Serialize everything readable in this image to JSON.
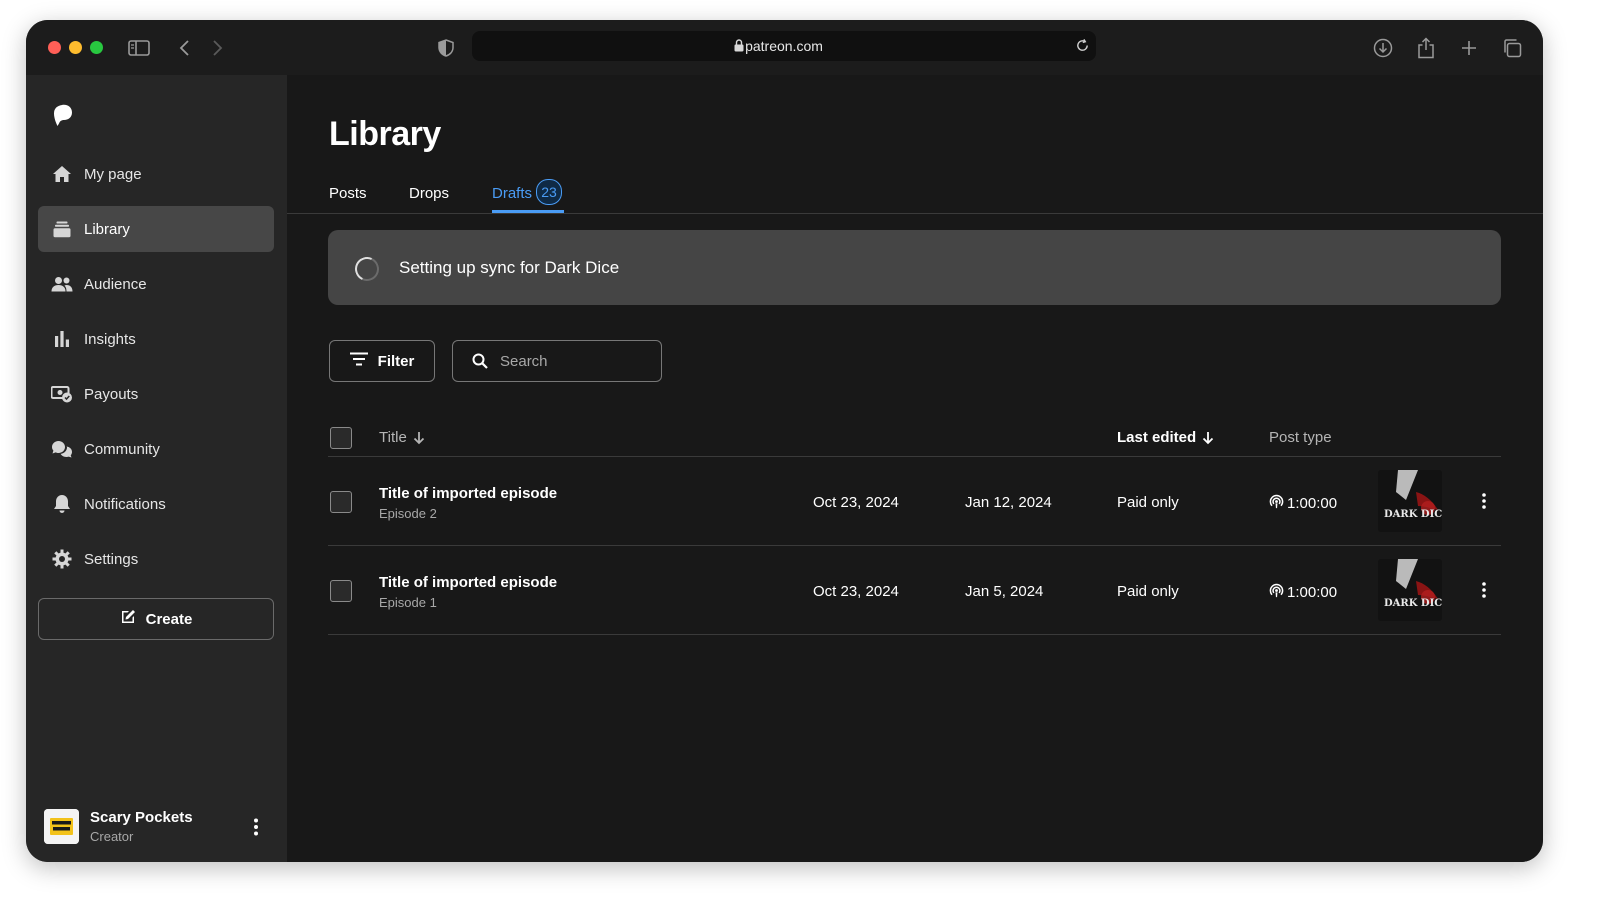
{
  "browser": {
    "url": "patreon.com"
  },
  "sidebar": {
    "items": [
      {
        "label": "My page",
        "icon": "home-icon"
      },
      {
        "label": "Library",
        "icon": "library-icon",
        "active": true
      },
      {
        "label": "Audience",
        "icon": "audience-icon"
      },
      {
        "label": "Insights",
        "icon": "insights-icon"
      },
      {
        "label": "Payouts",
        "icon": "payouts-icon"
      },
      {
        "label": "Community",
        "icon": "community-icon"
      },
      {
        "label": "Notifications",
        "icon": "bell-icon"
      },
      {
        "label": "Settings",
        "icon": "gear-icon"
      }
    ],
    "create_label": "Create",
    "profile": {
      "name": "Scary Pockets",
      "role": "Creator"
    }
  },
  "main": {
    "title": "Library",
    "tabs": [
      {
        "label": "Posts"
      },
      {
        "label": "Drops"
      },
      {
        "label": "Drafts",
        "badge": "23",
        "active": true
      }
    ],
    "sync_banner": "Setting up sync for Dark Dice",
    "filter_label": "Filter",
    "search": {
      "placeholder": "Search",
      "value": ""
    },
    "table": {
      "headers": {
        "title": "Title",
        "last_edited": "Last edited",
        "post_type": "Post type"
      },
      "rows": [
        {
          "title": "Title of imported episode",
          "subtitle": "Episode 2",
          "date1": "Oct 23, 2024",
          "date2": "Jan 12, 2024",
          "access": "Paid only",
          "duration": "1:00:00",
          "thumb_text": "DARK DICE"
        },
        {
          "title": "Title of imported episode",
          "subtitle": "Episode 1",
          "date1": "Oct 23, 2024",
          "date2": "Jan 5, 2024",
          "access": "Paid only",
          "duration": "1:00:00",
          "thumb_text": "DARK DICE"
        }
      ]
    }
  },
  "colors": {
    "accent": "#4a9cf5",
    "sidebar_bg": "#262626",
    "main_bg": "#181818",
    "banner_bg": "#454545"
  }
}
